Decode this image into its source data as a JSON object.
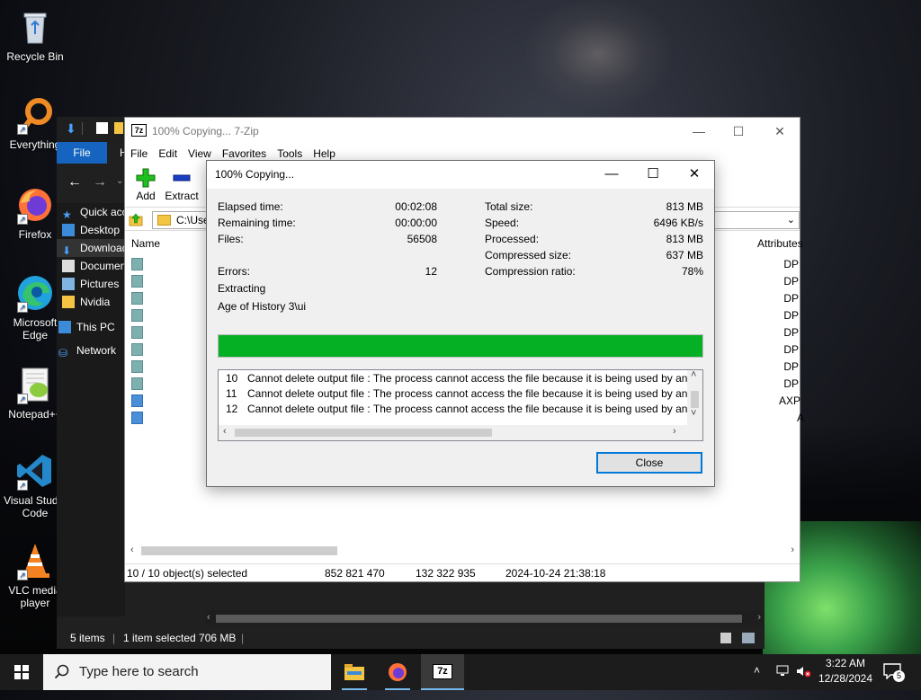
{
  "desktop": {
    "icons": [
      {
        "label": "Recycle Bin"
      },
      {
        "label": "Everything"
      },
      {
        "label": "Firefox"
      },
      {
        "label": "Microsoft Edge"
      },
      {
        "label": "Notepad++"
      },
      {
        "label": "Visual Studio Code"
      },
      {
        "label": "VLC media player"
      }
    ]
  },
  "explorer": {
    "file_tab": "File",
    "tab2": "H",
    "sidebar": [
      {
        "label": "Quick access"
      },
      {
        "label": "Desktop"
      },
      {
        "label": "Downloads"
      },
      {
        "label": "Documents"
      },
      {
        "label": "Pictures"
      },
      {
        "label": "Nvidia"
      },
      {
        "label": "This PC"
      },
      {
        "label": "Network"
      }
    ],
    "status": {
      "items": "5 items",
      "selected": "1 item selected  706 MB"
    }
  },
  "zip_manager": {
    "title": "100% Copying... 7-Zip",
    "menu": [
      "File",
      "Edit",
      "View",
      "Favorites",
      "Tools",
      "Help"
    ],
    "toolbar": {
      "add": "Add",
      "extract": "Extract"
    },
    "address": "C:\\Use",
    "columns": {
      "name": "Name",
      "attributes": "Attributes"
    },
    "rows": [
      {
        "attr": "DP"
      },
      {
        "attr": "DP"
      },
      {
        "attr": "DP"
      },
      {
        "attr": "DP"
      },
      {
        "attr": "DP"
      },
      {
        "attr": "DP"
      },
      {
        "attr": "DP"
      },
      {
        "attr": "DP"
      },
      {
        "attr": "AXP"
      },
      {
        "attr": "A"
      }
    ],
    "status": {
      "selected": "10 / 10 object(s) selected",
      "size": "852 821 470",
      "packed": "132 322 935",
      "modified": "2024-10-24 21:38:18"
    }
  },
  "copy_dialog": {
    "title": "100% Copying...",
    "left": {
      "elapsed_label": "Elapsed time:",
      "elapsed": "00:02:08",
      "remaining_label": "Remaining time:",
      "remaining": "00:00:00",
      "files_label": "Files:",
      "files": "56508",
      "errors_label": "Errors:",
      "errors": "12"
    },
    "right": {
      "total_label": "Total size:",
      "total": "813 MB",
      "speed_label": "Speed:",
      "speed": "6496 KB/s",
      "processed_label": "Processed:",
      "processed": "813 MB",
      "compressed_label": "Compressed size:",
      "compressed": "637 MB",
      "ratio_label": "Compression ratio:",
      "ratio": "78%"
    },
    "operation": "Extracting",
    "current_path": "Age of History 3\\ui",
    "progress": 1.0,
    "progress_color": "#06b025",
    "log": [
      {
        "n": "10",
        "msg": "Cannot delete output file : The process cannot access the file because it is being used by another proce"
      },
      {
        "n": "11",
        "msg": "Cannot delete output file : The process cannot access the file because it is being used by another proce"
      },
      {
        "n": "12",
        "msg": "Cannot delete output file : The process cannot access the file because it is being used by another proce"
      }
    ],
    "close_label": "Close"
  },
  "taskbar": {
    "search_placeholder": "Type here to search",
    "time": "3:22 AM",
    "date": "12/28/2024",
    "notifications": "5"
  }
}
